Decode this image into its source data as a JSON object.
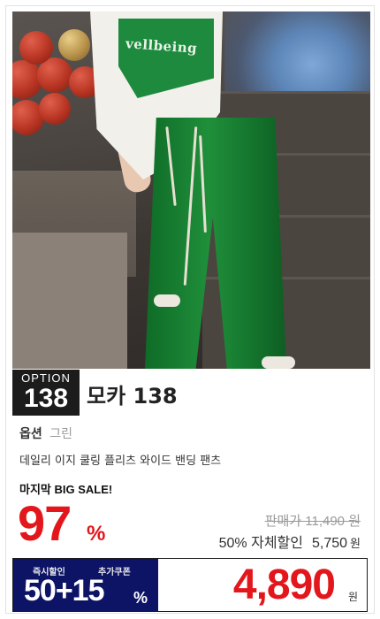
{
  "product": {
    "image_shirt_text": "vellbeing",
    "option_badge": {
      "label": "OPTION",
      "number": "138"
    },
    "title": "모카 138",
    "option": {
      "key": "옵션",
      "value": "그린"
    },
    "description": "데일리 이지 쿨링 플리츠 와이드 밴딩 팬츠"
  },
  "sale": {
    "tag": "마지막 BIG SALE!",
    "percent": "97",
    "percent_sign": "%",
    "original_price": "판매가 11,490 원",
    "self_discount_label": "50% 자체할인",
    "self_discount_price": "5,750",
    "won": "원"
  },
  "coupon": {
    "label_instant": "즉시할인",
    "label_extra": "추가쿠폰",
    "value": "50+15",
    "percent_sign": "%"
  },
  "final": {
    "price": "4,890",
    "won": "원"
  },
  "colors": {
    "accent_red": "#e3161c",
    "coupon_navy": "#0d1466",
    "badge_black": "#1c1c1c",
    "pants_green": "#1f8f3a"
  }
}
